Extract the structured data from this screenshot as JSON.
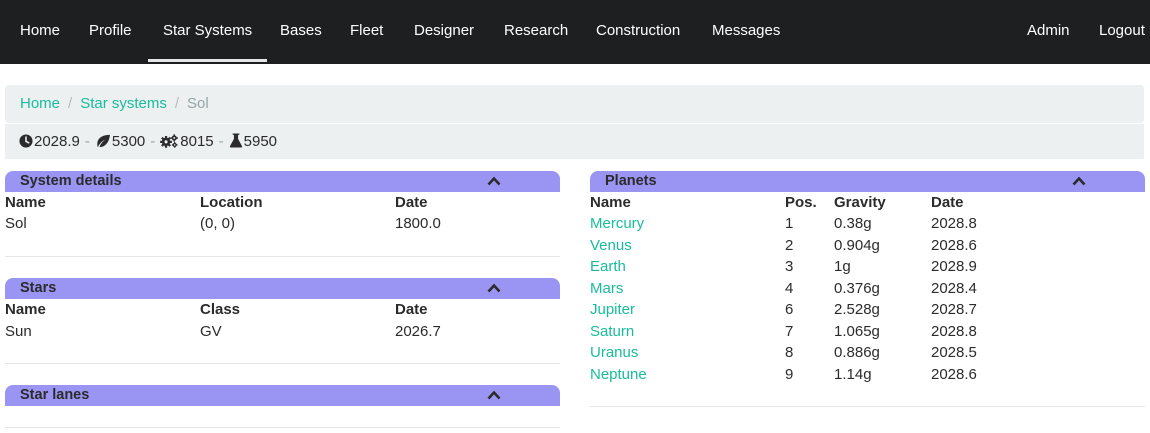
{
  "nav": {
    "left": [
      "Home",
      "Profile",
      "Star Systems",
      "Bases",
      "Fleet",
      "Designer",
      "Research",
      "Construction",
      "Messages"
    ],
    "right": [
      "Admin",
      "Logout"
    ],
    "active": "Star Systems"
  },
  "breadcrumb": {
    "items": [
      "Home",
      "Star systems"
    ],
    "current": "Sol"
  },
  "info": {
    "date": "2028.9",
    "food": "5300",
    "industry": "8015",
    "research": "5950",
    "separator": "-"
  },
  "system_details": {
    "title": "System details",
    "columns": [
      "Name",
      "Location",
      "Date"
    ],
    "row": [
      "Sol",
      "(0, 0)",
      "1800.0"
    ]
  },
  "stars": {
    "title": "Stars",
    "columns": [
      "Name",
      "Class",
      "Date"
    ],
    "row": [
      "Sun",
      "GV",
      "2026.7"
    ]
  },
  "star_lanes": {
    "title": "Star lanes"
  },
  "planets": {
    "title": "Planets",
    "columns": [
      "Name",
      "Pos.",
      "Gravity",
      "Date"
    ],
    "rows": [
      [
        "Mercury",
        "1",
        "0.38g",
        "2028.8"
      ],
      [
        "Venus",
        "2",
        "0.904g",
        "2028.6"
      ],
      [
        "Earth",
        "3",
        "1g",
        "2028.9"
      ],
      [
        "Mars",
        "4",
        "0.376g",
        "2028.4"
      ],
      [
        "Jupiter",
        "6",
        "2.528g",
        "2028.7"
      ],
      [
        "Saturn",
        "7",
        "1.065g",
        "2028.8"
      ],
      [
        "Uranus",
        "8",
        "0.886g",
        "2028.5"
      ],
      [
        "Neptune",
        "9",
        "1.14g",
        "2028.6"
      ]
    ]
  },
  "icons": {
    "date": "clock-icon",
    "food": "leaf-icon",
    "industry": "gears-icon",
    "research": "flask-icon",
    "collapse": "chevron-up-icon"
  },
  "colors": {
    "navbar": "#1e1f20",
    "accent": "#18bc9c",
    "panel_header": "#9a95f3",
    "breadcrumb_bg": "#ecf0f1"
  }
}
